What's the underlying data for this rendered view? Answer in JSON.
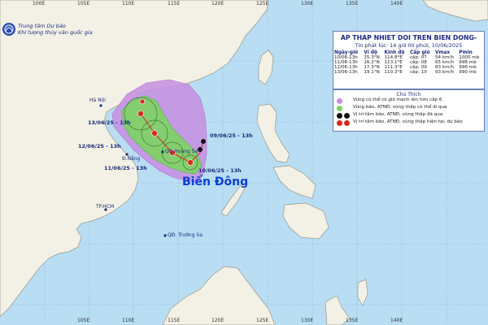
{
  "org": {
    "line1": "Trung tâm Dự báo",
    "line2": "Khí tượng thủy văn quốc gia"
  },
  "lon_ticks_top": [
    "100E",
    "105E",
    "110E",
    "115E",
    "120E",
    "125E",
    "130E",
    "135E",
    "140E"
  ],
  "lon_ticks_bottom": [
    "105E",
    "110E",
    "115E",
    "120E",
    "125E",
    "130E",
    "135E",
    "140E"
  ],
  "places": {
    "hanoi": "Hà Nội",
    "danang": "Đ.Nẵng",
    "hoangsa": "QĐ Hoàng Sa",
    "hcm": "TP.HCM",
    "truongsa": "QĐ. Trường Sa",
    "sea": "Biển Đông"
  },
  "track_labels": {
    "d13": "13/06/25 - 13h",
    "d12": "12/06/25 - 13h",
    "d11": "11/06/25 - 13h",
    "d10": "10/06/25 - 13h",
    "d09": "09/06/25 - 13h"
  },
  "bulletin": {
    "title": "AP THAP NHIET DOI TREN BIEN DONG-",
    "issued": "Tin phát lúc: 14 giờ 00 phút, 10/06/2025",
    "headers": [
      "Ngày-giờ",
      "Vĩ độ",
      "Kinh độ",
      "Cấp gió",
      "Vmax",
      "Pmin"
    ],
    "rows": [
      [
        "10/06-13h",
        "15.3°N",
        "114.8°E",
        "cấp: 07",
        "54 km/h",
        "1000 mb"
      ],
      [
        "11/06-13h",
        "16.2°N",
        "113.1°E",
        "cấp: 08",
        "65 km/h",
        "998 mb"
      ],
      [
        "12/06-13h",
        "17.3°N",
        "111.3°E",
        "cấp: 09",
        "83 km/h",
        "996 mb"
      ],
      [
        "13/06-13h",
        "19.1°N",
        "110.3°E",
        "cấp: 10",
        "93 km/h",
        "990 mb"
      ]
    ]
  },
  "legend": {
    "title": "Chú Thích",
    "items": [
      "Vùng có thể có gió mạnh lên hơn cấp 6",
      "Vùng bão, ATNĐ, vùng thấp có thể đi qua",
      "Vị trí tâm bão, ATNĐ, vùng thấp đã qua",
      "Vị trí tâm bão, ATNĐ, vùng thấp hiện tại, dự báo"
    ]
  },
  "colors": {
    "sea": "#b9ddf3",
    "land": "#f3f1e6",
    "coast": "#9a9888",
    "wind_zone": "#c68ee0",
    "track_zone": "#7ed463",
    "track_line": "#d72a1f",
    "label": "#1b2a7a"
  },
  "icons": [
    "logo-icon",
    "storm-past-icon",
    "storm-forecast-icon"
  ]
}
